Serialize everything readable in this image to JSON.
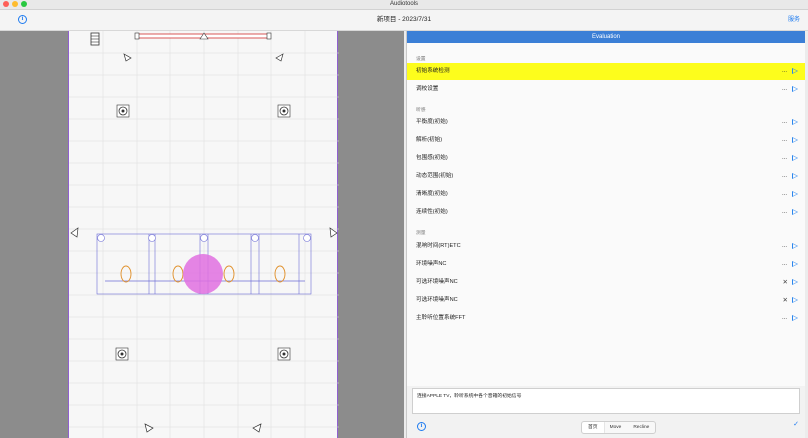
{
  "window": {
    "app_title": "Audiotools",
    "traffic_colors": [
      "#fe5f57",
      "#febc2e",
      "#28c840"
    ]
  },
  "toolbar": {
    "doc_title": "新项目 - 2023/7/31",
    "save_label": "服务"
  },
  "canvas": {
    "room_border_color": "#9060d0",
    "highlight_color": "#e070e0"
  },
  "panel": {
    "header": "Evaluation",
    "sections": [
      {
        "label": "设置",
        "items": [
          {
            "label": "初始系统检测",
            "dots": true,
            "selected": true
          },
          {
            "label": "调校设置",
            "dots": true
          }
        ]
      },
      {
        "label": "听感",
        "items": [
          {
            "label": "平衡度(初始)",
            "dots": true
          },
          {
            "label": "解析(初始)",
            "dots": true
          },
          {
            "label": "包围感(初始)",
            "dots": true
          },
          {
            "label": "动态范围(初始)",
            "dots": true
          },
          {
            "label": "清晰度(初始)",
            "dots": true
          },
          {
            "label": "连续性(初始)",
            "dots": true
          }
        ]
      },
      {
        "label": "测量",
        "items": [
          {
            "label": "混响时间(RT)ETC",
            "dots": true
          },
          {
            "label": "环境噪声NC",
            "dots": true
          },
          {
            "label": "可选环境噪声NC",
            "x": true
          },
          {
            "label": "可选环境噪声NC",
            "x": true
          },
          {
            "label": "主聆听位置系统FFT",
            "dots": true
          }
        ]
      }
    ],
    "notes": "连接APPLE TV，聆听系统中各个音箱的初始信号",
    "segments": [
      "首页",
      "Move",
      "Recline"
    ],
    "active_segment": 0
  }
}
